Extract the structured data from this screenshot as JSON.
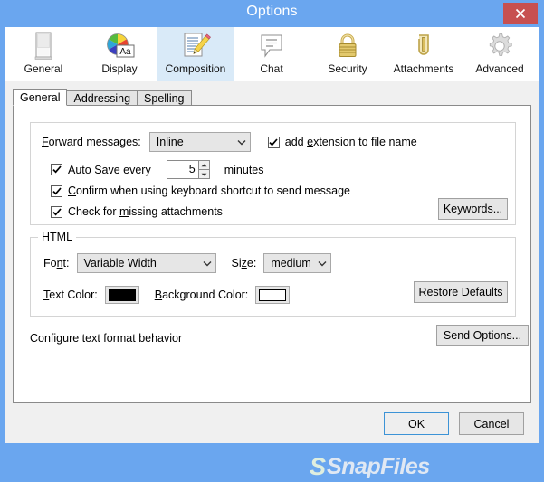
{
  "window": {
    "title": "Options",
    "close_label": "×",
    "accent_color": "#6aa6ef",
    "close_color": "#c75050",
    "panel_bg": "#f0f0f0",
    "selected_tab_bg": "#d9eaf8"
  },
  "toolbar": {
    "items": [
      {
        "label": "General",
        "icon": "monitor-icon",
        "selected": false
      },
      {
        "label": "Display",
        "icon": "color-wheel-aa-icon",
        "selected": false
      },
      {
        "label": "Composition",
        "icon": "document-pencil-icon",
        "selected": true
      },
      {
        "label": "Chat",
        "icon": "speech-bubble-icon",
        "selected": false
      },
      {
        "label": "Security",
        "icon": "padlock-icon",
        "selected": false
      },
      {
        "label": "Attachments",
        "icon": "paperclip-icon",
        "selected": false
      },
      {
        "label": "Advanced",
        "icon": "gear-icon",
        "selected": false
      }
    ]
  },
  "tabs": [
    {
      "label": "General",
      "active": true
    },
    {
      "label": "Addressing",
      "active": false
    },
    {
      "label": "Spelling",
      "active": false
    }
  ],
  "general_group": {
    "forward_messages_label": "Forward messages:",
    "forward_messages_value": "Inline",
    "forward_messages_options": [
      "Inline"
    ],
    "add_extension_label": "add extension to file name",
    "add_extension_checked": true,
    "auto_save_label": "Auto Save every",
    "auto_save_checked": true,
    "auto_save_value": "5",
    "auto_save_unit": "minutes",
    "confirm_shortcut_label": "Confirm when using keyboard shortcut to send message",
    "confirm_shortcut_checked": true,
    "check_attachments_label": "Check for missing attachments",
    "check_attachments_checked": true,
    "keywords_button": "Keywords..."
  },
  "html_group": {
    "title": "HTML",
    "font_label": "Font:",
    "font_value": "Variable Width",
    "font_options": [
      "Variable Width"
    ],
    "size_label": "Size:",
    "size_value": "medium",
    "size_options": [
      "medium"
    ],
    "text_color_label": "Text Color:",
    "text_color_value": "#000000",
    "background_color_label": "Background Color:",
    "background_color_value": "#ffffff",
    "restore_defaults_button": "Restore Defaults"
  },
  "footer_area": {
    "configure_text": "Configure text format behavior",
    "send_options_button": "Send Options..."
  },
  "watermark": {
    "logo": "S",
    "text": "SnapFiles"
  },
  "dialog_buttons": {
    "ok": "OK",
    "cancel": "Cancel"
  }
}
